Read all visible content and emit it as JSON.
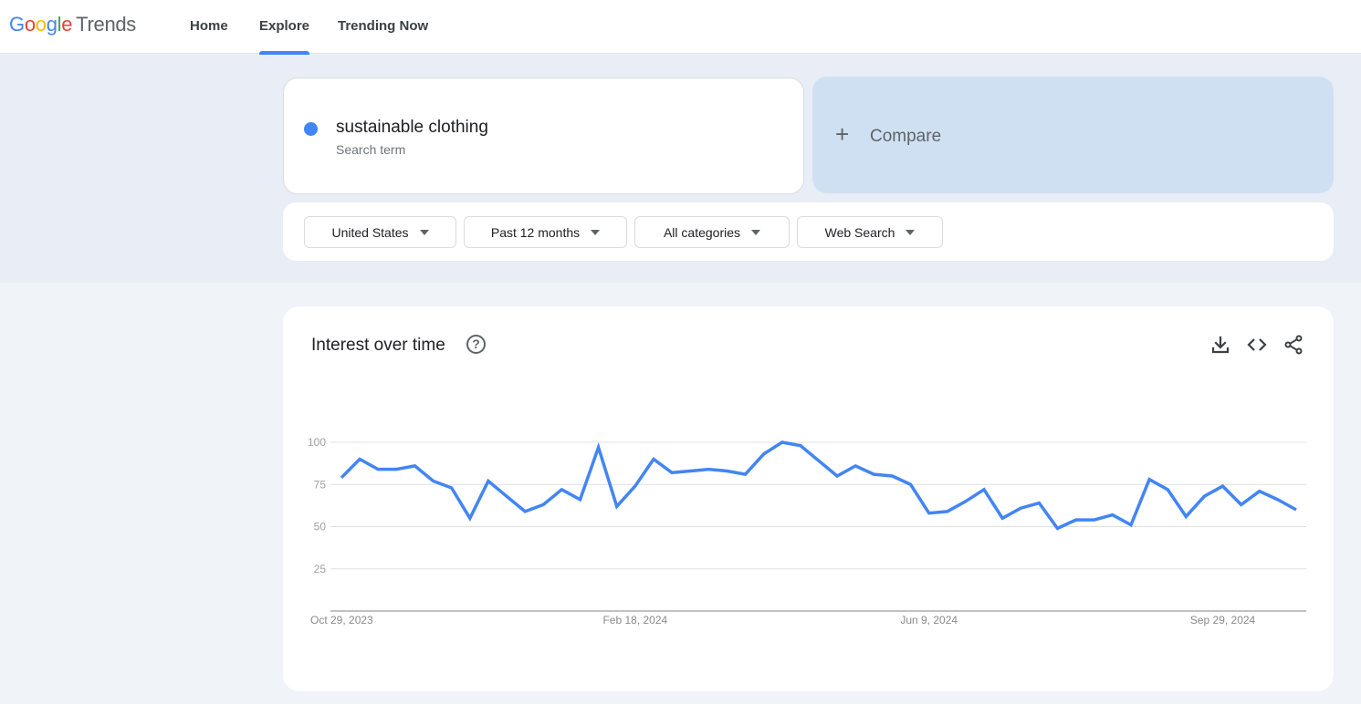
{
  "app": {
    "logo_letters": [
      "G",
      "o",
      "o",
      "g",
      "l",
      "e"
    ],
    "logo_suffix": "Trends"
  },
  "nav": {
    "items": [
      {
        "label": "Home",
        "active": false
      },
      {
        "label": "Explore",
        "active": true
      },
      {
        "label": "Trending Now",
        "active": false
      }
    ]
  },
  "search": {
    "term": "sustainable clothing",
    "term_type": "Search term",
    "term_color": "#4285f4",
    "compare_icon": "plus-icon",
    "compare_label": "Compare"
  },
  "filters": [
    {
      "label": "United States"
    },
    {
      "label": "Past 12 months"
    },
    {
      "label": "All categories"
    },
    {
      "label": "Web Search"
    }
  ],
  "panel": {
    "title": "Interest over time",
    "help_icon": "?",
    "actions": [
      "download-icon",
      "embed-code-icon",
      "share-icon"
    ]
  },
  "chart_data": {
    "type": "line",
    "title": "Interest over time",
    "xlabel": "",
    "ylabel": "",
    "ylim": [
      0,
      100
    ],
    "yticks": [
      25,
      50,
      75,
      100
    ],
    "grid": true,
    "x_start": "Oct 29, 2023",
    "x_interval": "weekly",
    "xtick_labels": [
      {
        "index": 0,
        "label": "Oct 29, 2023"
      },
      {
        "index": 16,
        "label": "Feb 18, 2024"
      },
      {
        "index": 32,
        "label": "Jun 9, 2024"
      },
      {
        "index": 48,
        "label": "Sep 29, 2024"
      }
    ],
    "series": [
      {
        "name": "sustainable clothing",
        "color": "#4285f4",
        "values": [
          79,
          90,
          84,
          84,
          86,
          77,
          73,
          55,
          77,
          68,
          59,
          63,
          72,
          66,
          97,
          62,
          74,
          90,
          82,
          83,
          84,
          83,
          81,
          93,
          100,
          98,
          89,
          80,
          86,
          81,
          80,
          75,
          58,
          59,
          65,
          72,
          55,
          61,
          64,
          49,
          54,
          54,
          57,
          51,
          78,
          72,
          56,
          68,
          74,
          63,
          71,
          66,
          60
        ]
      }
    ]
  }
}
